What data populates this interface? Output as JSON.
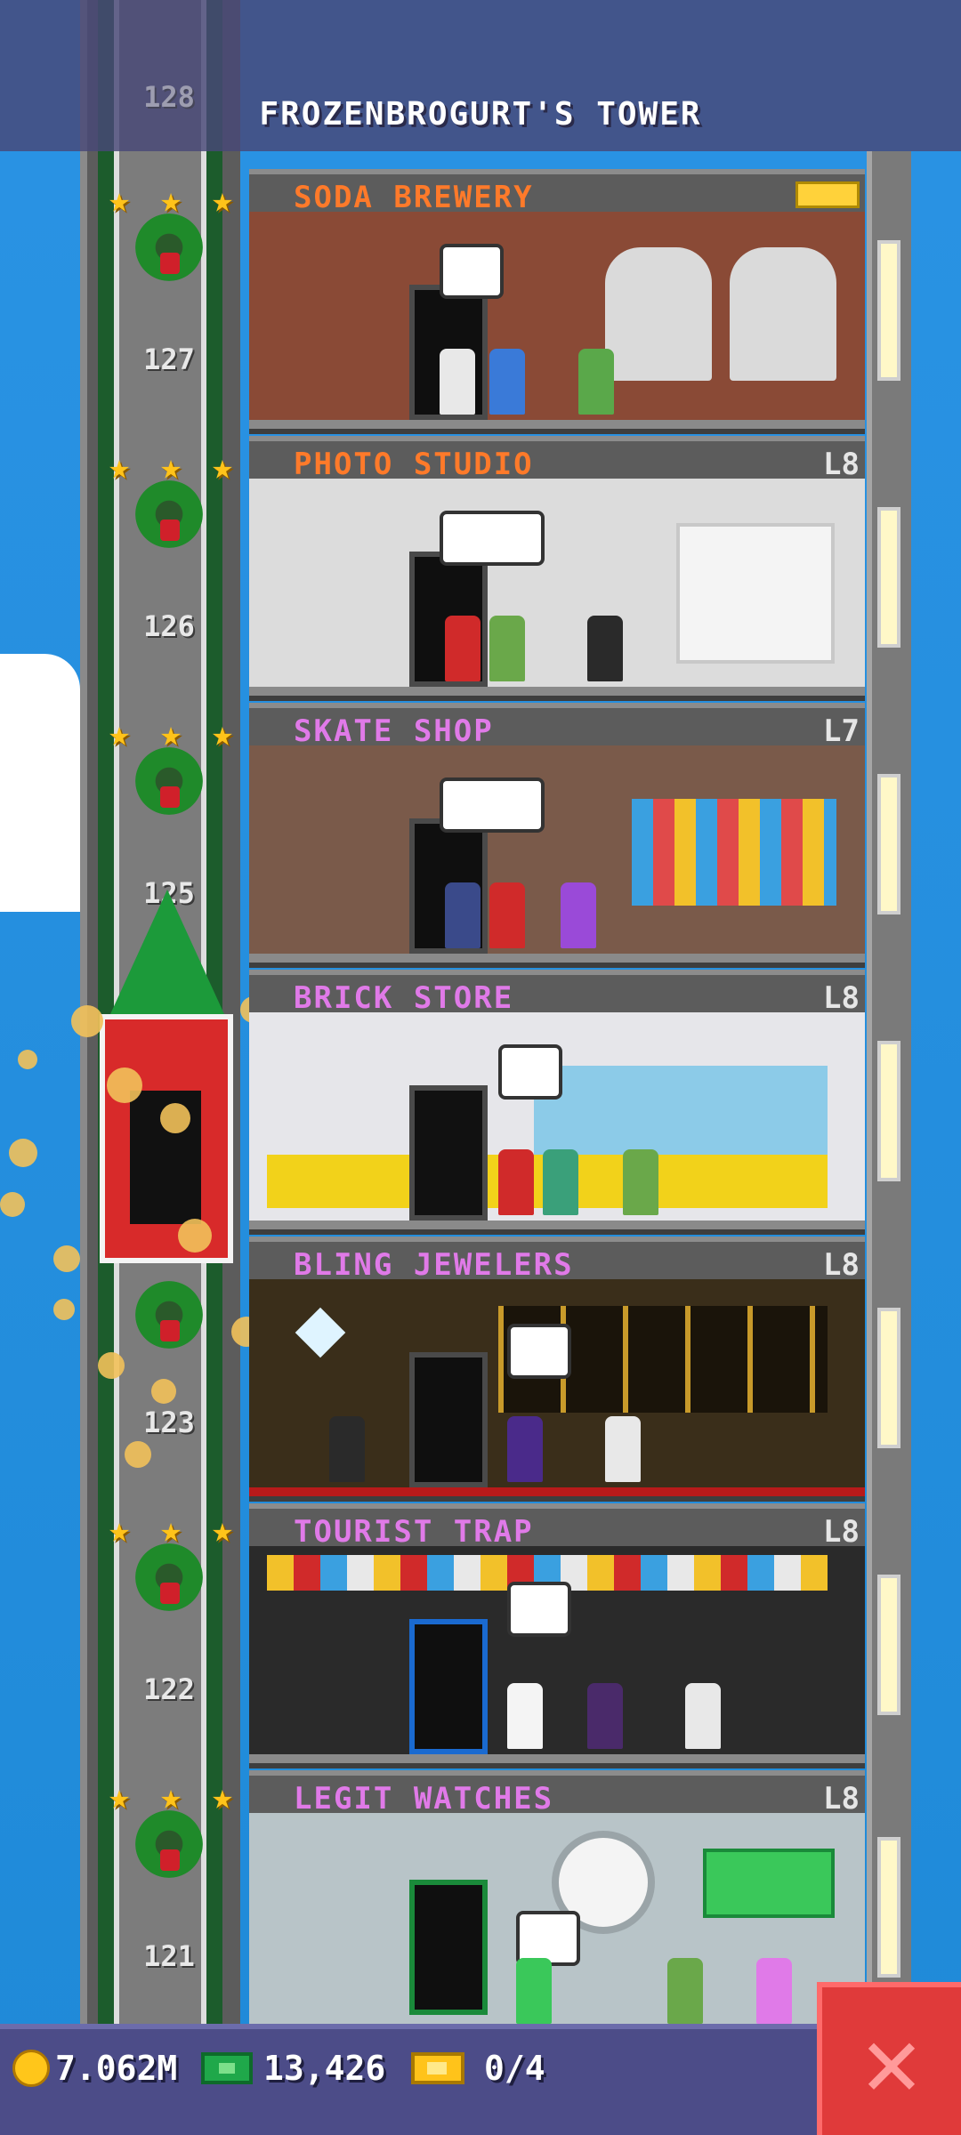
{
  "header": {
    "title": "FROZENBROGURT'S TOWER"
  },
  "shaft_numbers": [
    "128",
    "127",
    "126",
    "125",
    "123",
    "122",
    "121"
  ],
  "floors": [
    {
      "name": "SODA BREWERY",
      "level": "",
      "name_color": "#ff7a2a",
      "badge": "gold-bux-badge",
      "wall": "#8a4a36"
    },
    {
      "name": "PHOTO STUDIO",
      "level": "L8",
      "name_color": "#ff7a2a",
      "wall": "#dcdcdc"
    },
    {
      "name": "SKATE SHOP",
      "level": "L7",
      "name_color": "#e07ae8",
      "wall": "#7a5a4a"
    },
    {
      "name": "BRICK STORE",
      "level": "L8",
      "name_color": "#e07ae8",
      "wall": "#e6e6ea"
    },
    {
      "name": "BLING JEWELERS",
      "level": "L8",
      "name_color": "#e07ae8",
      "wall": "#3a2e1a"
    },
    {
      "name": "TOURIST TRAP",
      "level": "L8",
      "name_color": "#e07ae8",
      "wall": "#2a2a2a"
    },
    {
      "name": "LEGIT WATCHES",
      "level": "L8",
      "name_color": "#e07ae8",
      "wall": "#b8c4c8"
    }
  ],
  "status_bar": {
    "coins": "7.062M",
    "bux": "13,426",
    "tickets": "0/4"
  },
  "icons": {
    "coin": "coin-icon",
    "bux": "bux-icon",
    "ticket": "golden-ticket-icon",
    "close": "close-icon"
  },
  "colors": {
    "accent_close": "#e03a3a",
    "bar": "#4c4c88"
  }
}
